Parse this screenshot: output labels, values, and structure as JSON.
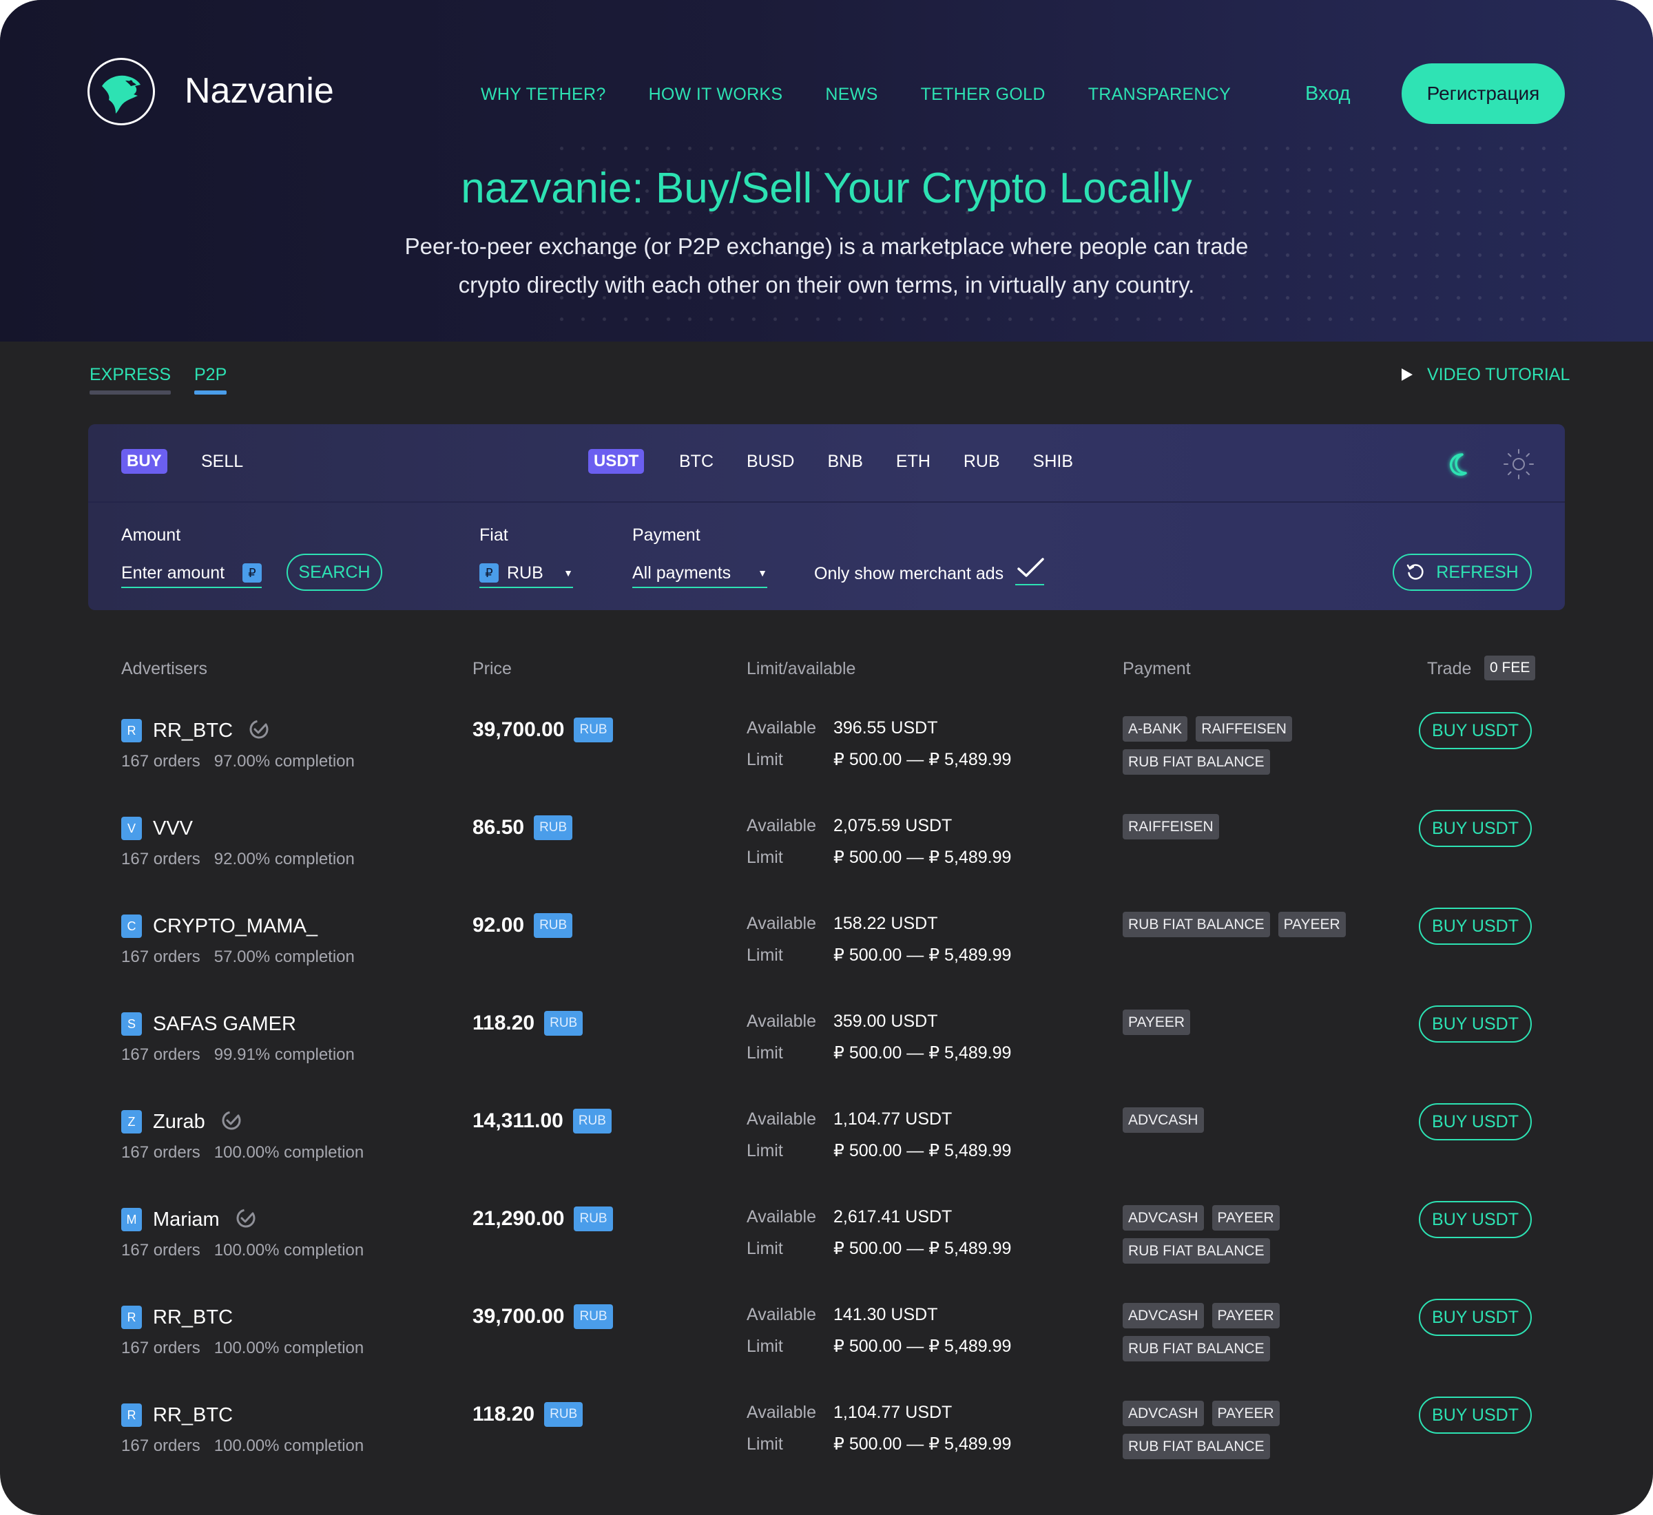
{
  "header": {
    "brand_name": "Nazvanie",
    "nav": [
      "WHY TETHER?",
      "HOW IT WORKS",
      "NEWS",
      "TETHER GOLD",
      "TRANSPARENCY"
    ],
    "login": "Вход",
    "register": "Регистрация"
  },
  "hero": {
    "title": "nazvanie: Buy/Sell Your Crypto Locally",
    "subtitle_line1": "Peer-to-peer exchange (or P2P exchange) is a marketplace where people can trade",
    "subtitle_line2": "crypto directly with each other on their own terms, in virtually any country."
  },
  "mode_tabs": [
    {
      "label": "EXPRESS",
      "underline": "#4a4b5a"
    },
    {
      "label": "P2P",
      "underline": "#4a9dea"
    }
  ],
  "video_tutorial": "VIDEO TUTORIAL",
  "panel": {
    "side_active": "BUY",
    "side_other": "SELL",
    "coin_active": "USDT",
    "coins": [
      "BTC",
      "BUSD",
      "BNB",
      "ETH",
      "RUB",
      "SHIB"
    ],
    "amount_label": "Amount",
    "amount_placeholder": "Enter amount",
    "rub_sign": "₽",
    "search": "SEARCH",
    "fiat_label": "Fiat",
    "fiat_value": "RUB",
    "payment_label": "Payment",
    "payment_value": "All payments",
    "merchant_label": "Only show merchant ads",
    "refresh": "REFRESH"
  },
  "table": {
    "headers": {
      "advertisers": "Advertisers",
      "price": "Price",
      "limit": "Limit/available",
      "payment": "Payment",
      "trade": "Trade",
      "fee": "0 FEE"
    },
    "available_label": "Available",
    "limit_label": "Limit",
    "buy_label": "BUY USDT",
    "rows": [
      {
        "initial": "R",
        "name": "RR_BTC",
        "verified": true,
        "orders": "167 orders",
        "completion": "97.00% completion",
        "price": "39,700.00",
        "currency": "RUB",
        "available": "396.55 USDT",
        "limit": "₽ 500.00 — ₽ 5,489.99",
        "payments": [
          "A-BANK",
          "RAIFFEISEN",
          "RUB FIAT BALANCE"
        ]
      },
      {
        "initial": "V",
        "name": "VVV",
        "verified": false,
        "orders": "167 orders",
        "completion": "92.00% completion",
        "price": "86.50",
        "currency": "RUB",
        "available": "2,075.59 USDT",
        "limit": "₽ 500.00 — ₽ 5,489.99",
        "payments": [
          "RAIFFEISEN"
        ]
      },
      {
        "initial": "C",
        "name": "CRYPTO_MAMA_",
        "verified": false,
        "orders": "167 orders",
        "completion": "57.00% completion",
        "price": "92.00",
        "currency": "RUB",
        "available": "158.22 USDT",
        "limit": "₽ 500.00 — ₽ 5,489.99",
        "payments": [
          "RUB FIAT BALANCE",
          "PAYEER"
        ]
      },
      {
        "initial": "S",
        "name": "SAFAS GAMER",
        "verified": false,
        "orders": "167 orders",
        "completion": "99.91% completion",
        "price": "118.20",
        "currency": "RUB",
        "available": "359.00 USDT",
        "limit": "₽ 500.00 — ₽ 5,489.99",
        "payments": [
          "PAYEER"
        ]
      },
      {
        "initial": "Z",
        "name": "Zurab",
        "verified": true,
        "orders": "167 orders",
        "completion": "100.00% completion",
        "price": "14,311.00",
        "currency": "RUB",
        "available": "1,104.77 USDT",
        "limit": "₽ 500.00 — ₽ 5,489.99",
        "payments": [
          "ADVCASH"
        ]
      },
      {
        "initial": "M",
        "name": "Mariam",
        "verified": true,
        "orders": "167 orders",
        "completion": "100.00% completion",
        "price": "21,290.00",
        "currency": "RUB",
        "available": "2,617.41 USDT",
        "limit": "₽ 500.00 — ₽ 5,489.99",
        "payments": [
          "ADVCASH",
          "PAYEER",
          "RUB FIAT BALANCE"
        ]
      },
      {
        "initial": "R",
        "name": "RR_BTC",
        "verified": false,
        "orders": "167 orders",
        "completion": "100.00% completion",
        "price": "39,700.00",
        "currency": "RUB",
        "available": "141.30 USDT",
        "limit": "₽ 500.00 — ₽ 5,489.99",
        "payments": [
          "ADVCASH",
          "PAYEER",
          "RUB FIAT BALANCE"
        ]
      },
      {
        "initial": "R",
        "name": "RR_BTC",
        "verified": false,
        "orders": "167 orders",
        "completion": "100.00% completion",
        "price": "118.20",
        "currency": "RUB",
        "available": "1,104.77 USDT",
        "limit": "₽ 500.00 — ₽ 5,489.99",
        "payments": [
          "ADVCASH",
          "PAYEER",
          "RUB FIAT BALANCE"
        ]
      }
    ]
  },
  "colors": {
    "accent": "#2de2b3",
    "active_chip": "#6b5ff0",
    "badge_blue": "#4a9dea",
    "page_bg": "#232325"
  }
}
